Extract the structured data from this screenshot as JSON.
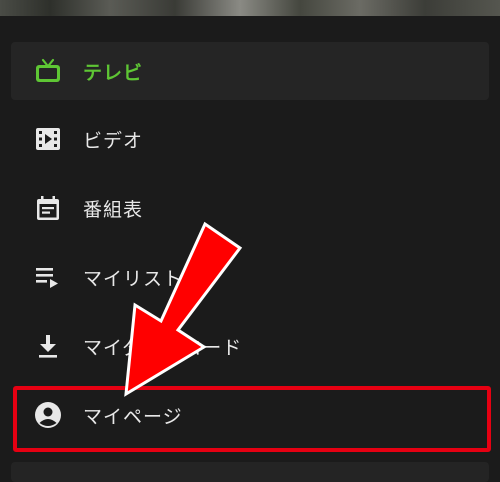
{
  "menu": {
    "items": [
      {
        "label": "テレビ",
        "icon": "tv-icon",
        "active": true
      },
      {
        "label": "ビデオ",
        "icon": "video-icon",
        "active": false
      },
      {
        "label": "番組表",
        "icon": "calendar-icon",
        "active": false
      },
      {
        "label": "マイリスト",
        "icon": "playlist-icon",
        "active": false
      },
      {
        "label": "マイダウンロード",
        "icon": "download-icon",
        "active": false
      },
      {
        "label": "マイページ",
        "icon": "account-icon",
        "active": false
      }
    ]
  },
  "colors": {
    "accent": "#5ec634",
    "highlight": "#e60012",
    "background": "#1b1b1b"
  }
}
